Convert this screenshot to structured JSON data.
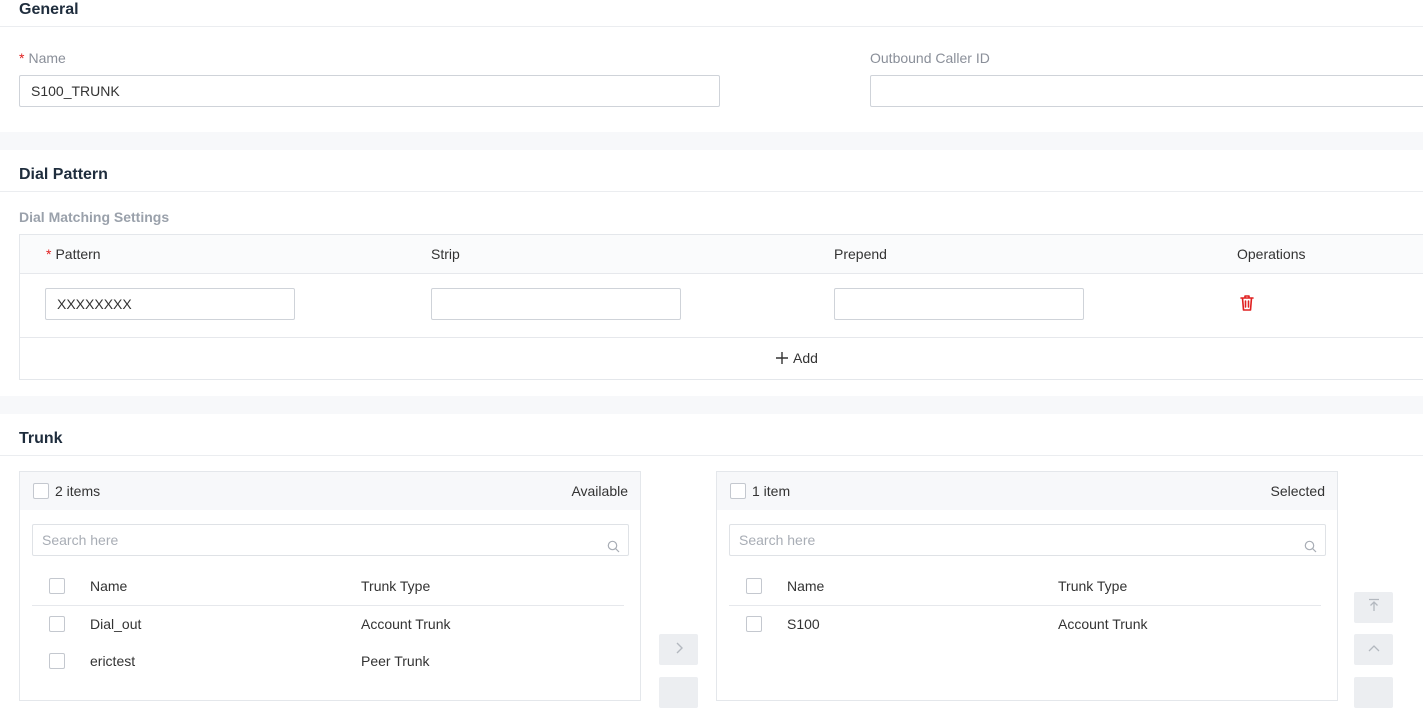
{
  "general": {
    "title": "General",
    "name_label": "Name",
    "name_value": "S100_TRUNK",
    "outbound_label": "Outbound Caller ID",
    "outbound_value": ""
  },
  "dial_pattern": {
    "title": "Dial Pattern",
    "subtitle": "Dial Matching Settings",
    "columns": [
      "Pattern",
      "Strip",
      "Prepend",
      "Operations"
    ],
    "rows": [
      {
        "pattern": "XXXXXXXX",
        "strip": "",
        "prepend": ""
      }
    ],
    "add_label": "Add"
  },
  "trunk": {
    "title": "Trunk",
    "available": {
      "count": "2 items",
      "header": "Available",
      "search_placeholder": "Search here",
      "columns": [
        "Name",
        "Trunk Type"
      ],
      "rows": [
        {
          "name": "Dial_out",
          "type": "Account Trunk"
        },
        {
          "name": "erictest",
          "type": "Peer Trunk"
        }
      ]
    },
    "selected": {
      "count": "1 item",
      "header": "Selected",
      "search_placeholder": "Search here",
      "columns": [
        "Name",
        "Trunk Type"
      ],
      "rows": [
        {
          "name": "S100",
          "type": "Account Trunk"
        }
      ]
    }
  },
  "colors": {
    "delete_icon": "#e02020",
    "required_mark": "#e02020"
  },
  "icons": [
    "delete-icon",
    "plus-icon",
    "search-icon",
    "chevron-right-icon",
    "move-top-icon",
    "chevron-up-icon"
  ]
}
